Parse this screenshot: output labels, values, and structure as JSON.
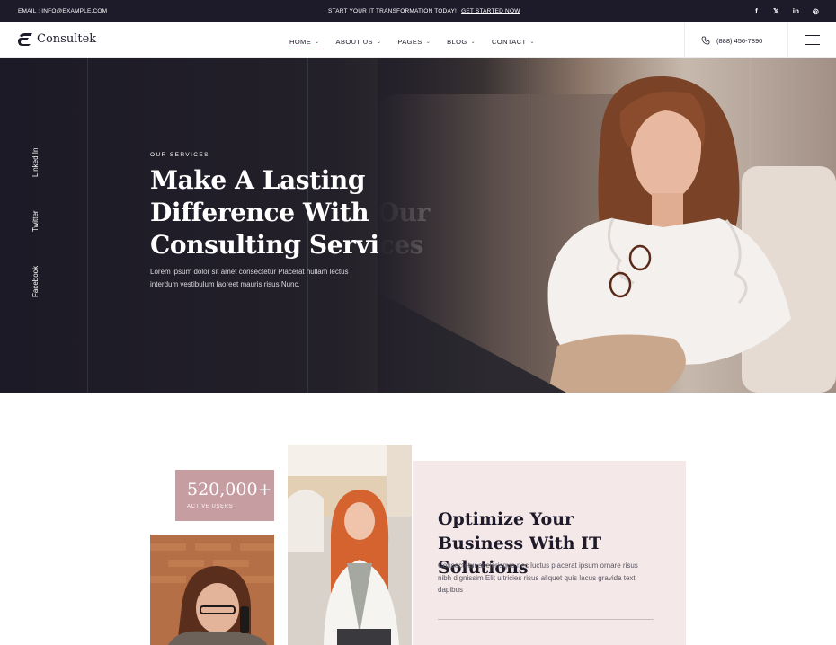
{
  "topbar": {
    "email": "EMAIL : INFO@EXAMPLE.COM",
    "promo_text": "START YOUR IT TRANSFORMATION TODAY!",
    "promo_link": "GET STARTED NOW",
    "social": [
      "f",
      "𝕏",
      "in",
      "◎"
    ]
  },
  "header": {
    "logo": "Consultek",
    "nav": [
      {
        "label": "HOME",
        "active": true
      },
      {
        "label": "ABOUT US",
        "active": false
      },
      {
        "label": "PAGES",
        "active": false
      },
      {
        "label": "BLOG",
        "active": false
      },
      {
        "label": "CONTACT",
        "active": false
      }
    ],
    "caret": "⌄",
    "phone": "(888) 456-7890"
  },
  "hero": {
    "social_links": [
      "Linked In",
      "Twitter",
      "Facebook"
    ],
    "tag": "OUR SERVICES",
    "title": "Make A Lasting Difference With Our Consulting Services",
    "text": "Lorem ipsum dolor sit amet consectetur Placerat nullam lectus interdum vestibulum laoreet mauris risus Nunc."
  },
  "stats": {
    "number": "520,000+",
    "label": "ACTIVE USERS"
  },
  "info": {
    "title": "Optimize Your Business With IT Solutions",
    "text": "Consectetur scelerisque nec luctus placerat ipsum ornare risus nibh dignissim Elit ultricies risus aliquet quis lacus gravida text dapibus"
  },
  "colors": {
    "dark": "#1d1a2a",
    "accent": "#c69ea1",
    "card_bg": "#f5e8e9"
  }
}
